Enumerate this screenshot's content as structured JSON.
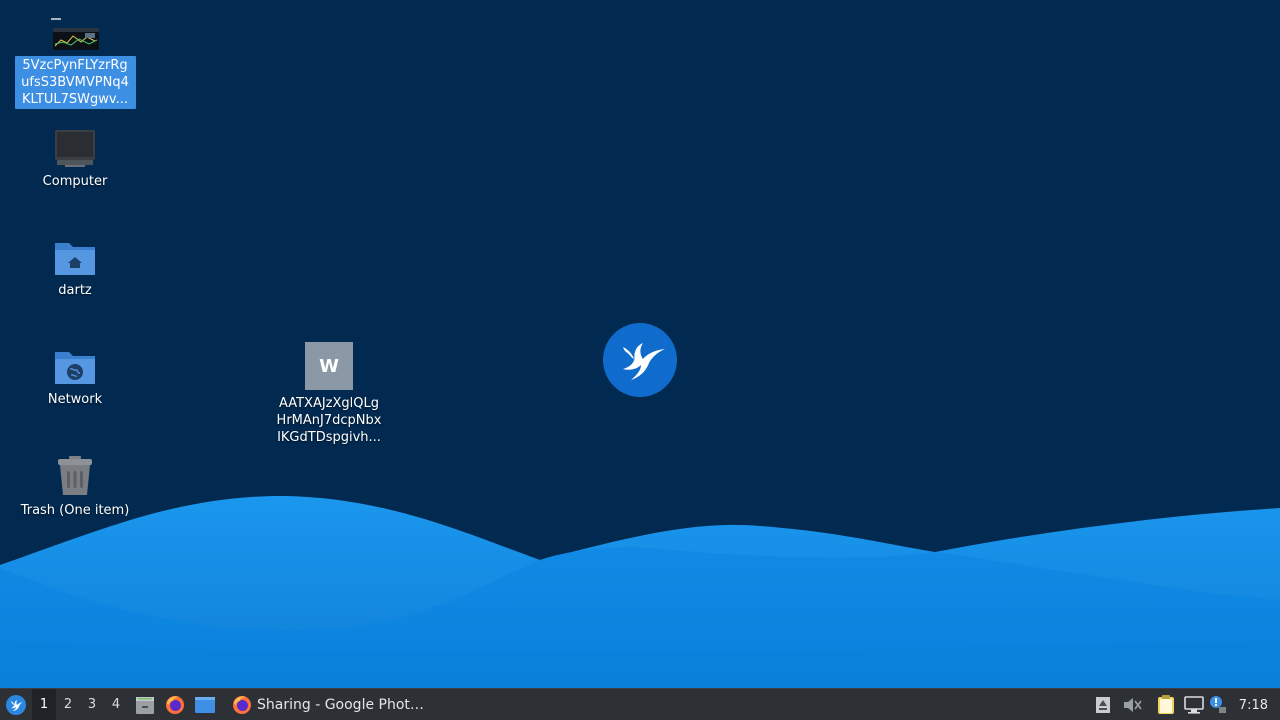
{
  "desktop": {
    "icons": [
      {
        "name": "file-image",
        "label": "5VzcPynFLYzrRg ufsS3BVMVPNq4 KLTUL7SWgwv..."
      },
      {
        "name": "computer",
        "label": "Computer"
      },
      {
        "name": "home-folder",
        "label": "dartz"
      },
      {
        "name": "network",
        "label": "Network"
      },
      {
        "name": "trash",
        "label": "Trash (One item)"
      },
      {
        "name": "document",
        "label": "AATXAJzXglQLg HrMAnJ7dcpNbx IKGdTDspgivh...",
        "glyph_letter": "W"
      }
    ]
  },
  "taskbar": {
    "workspaces": [
      "1",
      "2",
      "3",
      "4"
    ],
    "active_workspace": "1",
    "task_title": "Sharing - Google Phot…",
    "clock": "7:18"
  },
  "colors": {
    "background": "#022a51",
    "wave_light": "#1e9bf0",
    "wave_mid": "#0d84dc",
    "selection": "#3d8fe3",
    "taskbar": "#2d3136"
  }
}
